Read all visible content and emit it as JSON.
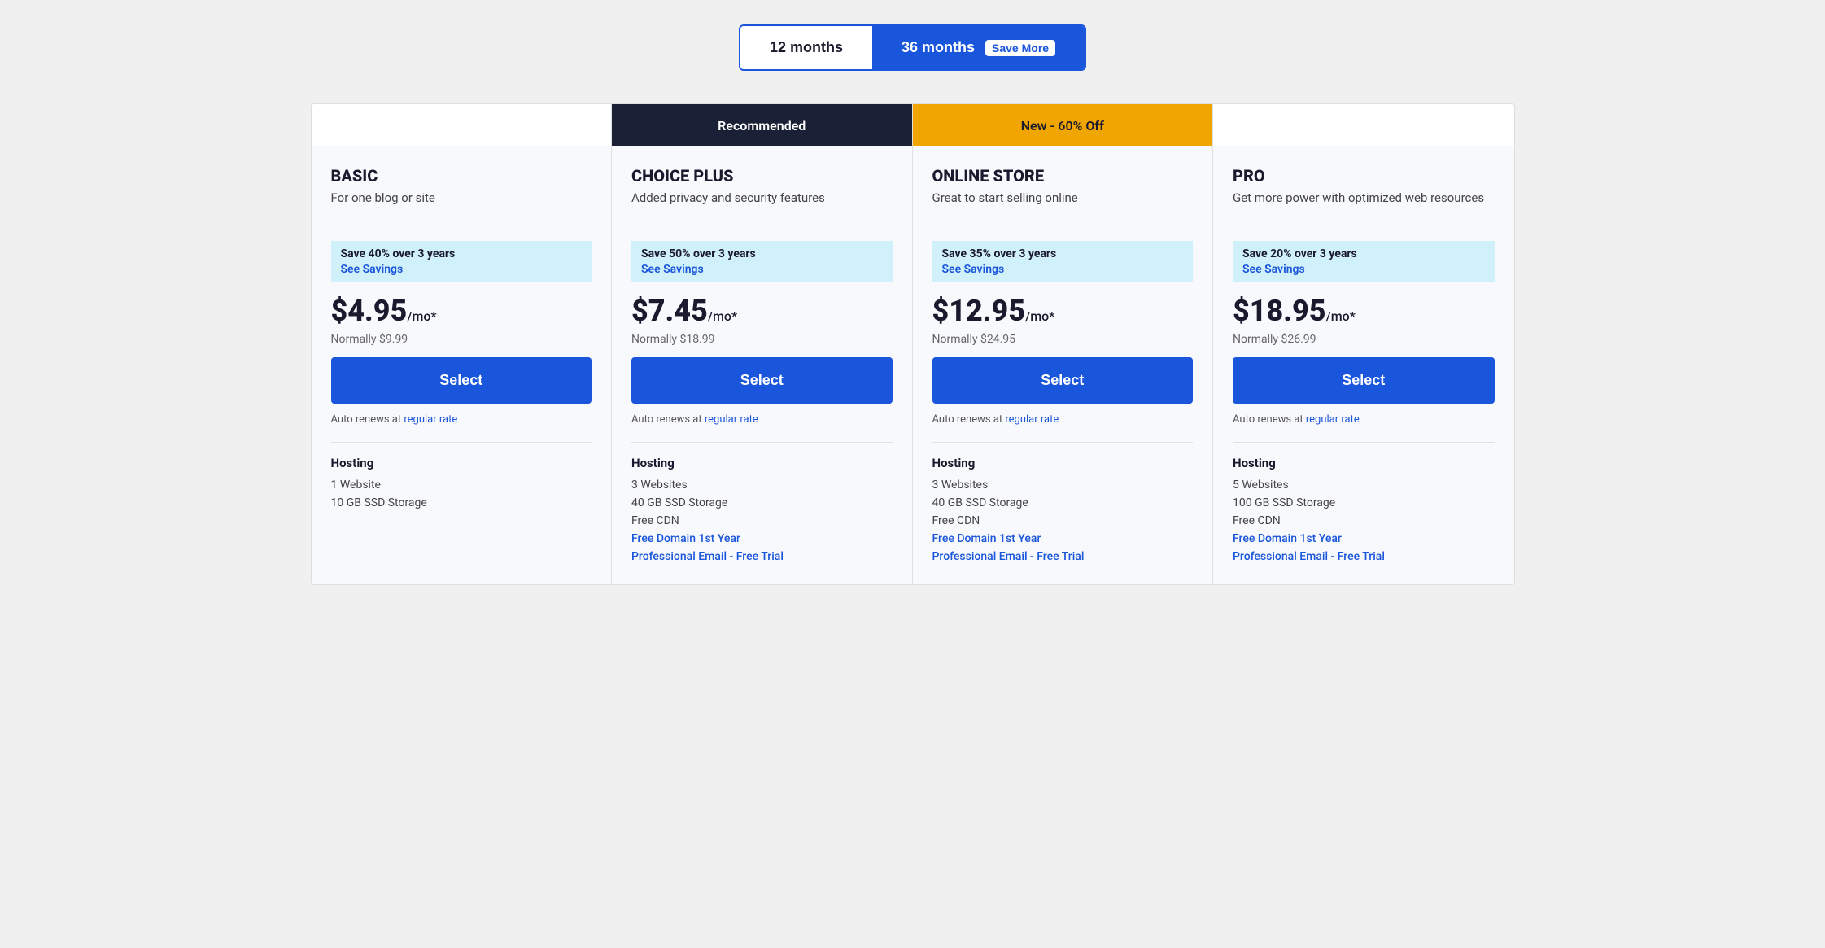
{
  "toggle": {
    "option12": "12 months",
    "option36": "36 months",
    "saveMore": "Save More"
  },
  "plans": [
    {
      "id": "basic",
      "banner": "",
      "bannerType": "empty",
      "name": "BASIC",
      "tagline": "For one blog or site",
      "savingsText": "Save 40% over 3 years",
      "seeSavings": "See Savings",
      "price": "$4.95",
      "priceUnit": "/mo*",
      "normalPrice": "$9.99",
      "selectLabel": "Select",
      "autoRenew": "Auto renews at",
      "regularRate": "regular rate",
      "hostingTitle": "Hosting",
      "features": [
        {
          "text": "1 Website",
          "blue": false
        },
        {
          "text": "10 GB SSD Storage",
          "blue": false
        }
      ]
    },
    {
      "id": "choice-plus",
      "banner": "Recommended",
      "bannerType": "recommended",
      "name": "CHOICE PLUS",
      "tagline": "Added privacy and security features",
      "savingsText": "Save 50% over 3 years",
      "seeSavings": "See Savings",
      "price": "$7.45",
      "priceUnit": "/mo*",
      "normalPrice": "$18.99",
      "selectLabel": "Select",
      "autoRenew": "Auto renews at",
      "regularRate": "regular rate",
      "hostingTitle": "Hosting",
      "features": [
        {
          "text": "3 Websites",
          "blue": false
        },
        {
          "text": "40 GB SSD Storage",
          "blue": false
        },
        {
          "text": "Free CDN",
          "blue": false
        },
        {
          "text": "Free Domain 1st Year",
          "blue": true
        },
        {
          "text": "Professional Email - Free Trial",
          "blue": true
        }
      ]
    },
    {
      "id": "online-store",
      "banner": "New - 60% Off",
      "bannerType": "new-offer",
      "name": "ONLINE STORE",
      "tagline": "Great to start selling online",
      "savingsText": "Save 35% over 3 years",
      "seeSavings": "See Savings",
      "price": "$12.95",
      "priceUnit": "/mo*",
      "normalPrice": "$24.95",
      "selectLabel": "Select",
      "autoRenew": "Auto renews at",
      "regularRate": "regular rate",
      "hostingTitle": "Hosting",
      "features": [
        {
          "text": "3 Websites",
          "blue": false
        },
        {
          "text": "40 GB SSD Storage",
          "blue": false
        },
        {
          "text": "Free CDN",
          "blue": false
        },
        {
          "text": "Free Domain 1st Year",
          "blue": true
        },
        {
          "text": "Professional Email - Free Trial",
          "blue": true
        }
      ]
    },
    {
      "id": "pro",
      "banner": "",
      "bannerType": "empty",
      "name": "PRO",
      "tagline": "Get more power with optimized web resources",
      "savingsText": "Save 20% over 3 years",
      "seeSavings": "See Savings",
      "price": "$18.95",
      "priceUnit": "/mo*",
      "normalPrice": "$26.99",
      "selectLabel": "Select",
      "autoRenew": "Auto renews at",
      "regularRate": "regular rate",
      "hostingTitle": "Hosting",
      "features": [
        {
          "text": "5 Websites",
          "blue": false
        },
        {
          "text": "100 GB SSD Storage",
          "blue": false
        },
        {
          "text": "Free CDN",
          "blue": false
        },
        {
          "text": "Free Domain 1st Year",
          "blue": true
        },
        {
          "text": "Professional Email - Free Trial",
          "blue": true
        }
      ]
    }
  ]
}
